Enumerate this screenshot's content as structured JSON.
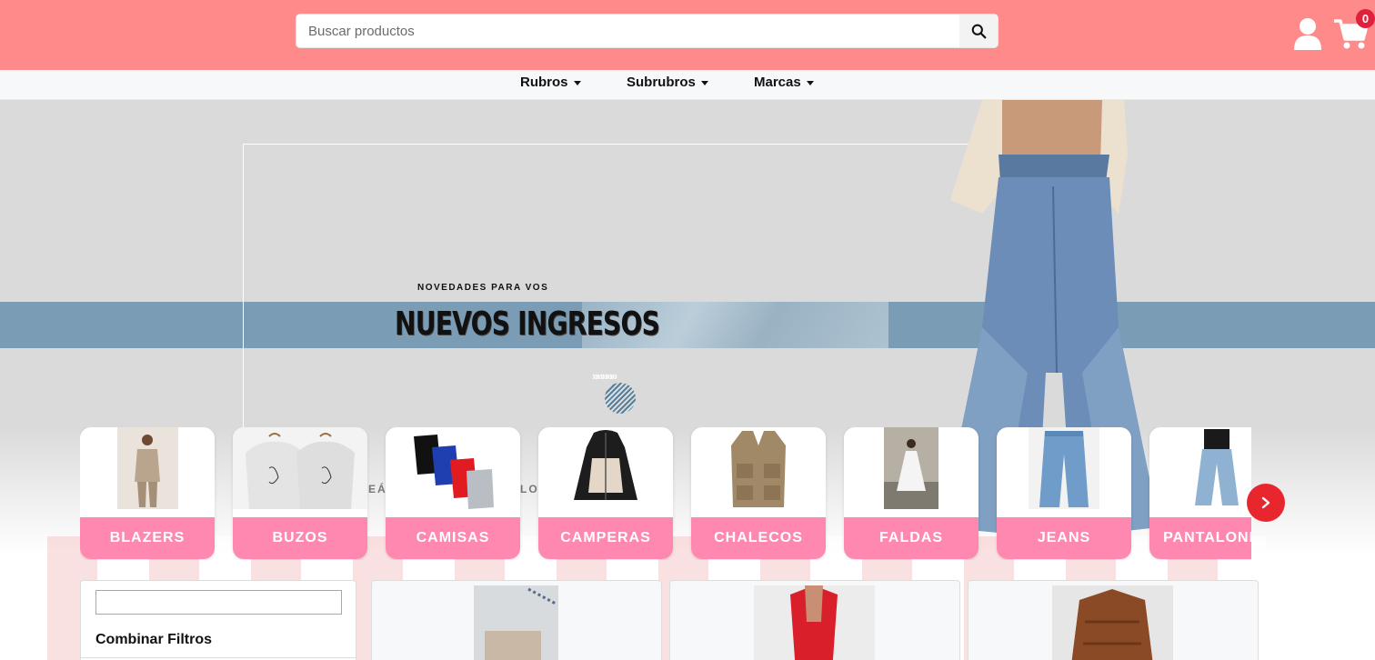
{
  "header": {
    "search": {
      "placeholder": "Buscar productos"
    },
    "cart_count": "0",
    "colors": {
      "header_bg": "#ff8a8a",
      "badge": "#e0203c"
    },
    "icons": [
      "search-icon",
      "user-icon",
      "cart-icon"
    ]
  },
  "nav": {
    "items": [
      {
        "label": "Rubros"
      },
      {
        "label": "Subrubros"
      },
      {
        "label": "Marcas"
      }
    ]
  },
  "hero": {
    "kicker": "NOVEDADES PARA VOS",
    "title": "NUEVOS INGRESOS",
    "arrows": "»»»»»",
    "faded_left": "EÁ",
    "faded_right": "LO"
  },
  "categories": {
    "items": [
      {
        "label": "BLAZERS"
      },
      {
        "label": "BUZOS"
      },
      {
        "label": "CAMISAS"
      },
      {
        "label": "CAMPERAS"
      },
      {
        "label": "CHALECOS"
      },
      {
        "label": "FALDAS"
      },
      {
        "label": "JEANS"
      },
      {
        "label": "PANTALONES"
      }
    ],
    "colors": {
      "label_bg": "#ff88b0",
      "next_button": "#e8262e"
    }
  },
  "filters": {
    "title": "Combinar Filtros"
  }
}
